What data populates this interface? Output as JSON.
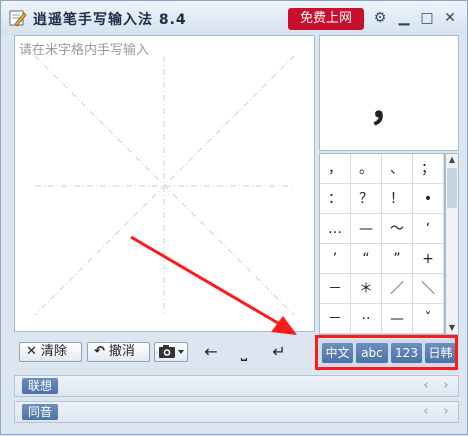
{
  "window": {
    "title": "逍遥笔手写输入法 8.4",
    "free_label": "免费上网"
  },
  "canvas": {
    "placeholder": "请在米字格内手写输入"
  },
  "toolbar": {
    "clear_label": "清除",
    "undo_label": "撤消"
  },
  "candidate": {
    "char": "，"
  },
  "symbols": [
    [
      "，",
      "。",
      "、",
      "；"
    ],
    [
      "：",
      "？",
      "！",
      "•"
    ],
    [
      "…",
      "—",
      "～",
      "‘"
    ],
    [
      "’",
      "“",
      "”",
      "+"
    ],
    [
      "－",
      "＊",
      "／",
      "＼"
    ],
    [
      "－",
      "··",
      "—",
      "ˇ"
    ]
  ],
  "modes": [
    "中文",
    "abc",
    "123",
    "日韩"
  ],
  "rows": [
    {
      "label": "联想"
    },
    {
      "label": "同音"
    }
  ],
  "colors": {
    "accent": "#c8102e",
    "mode_button": "#5a7db2",
    "annotation": "#ff1a1a"
  },
  "icons": [
    "pen-icon",
    "gear-icon",
    "minimize-icon",
    "maximize-icon",
    "close-icon",
    "camera-icon"
  ]
}
